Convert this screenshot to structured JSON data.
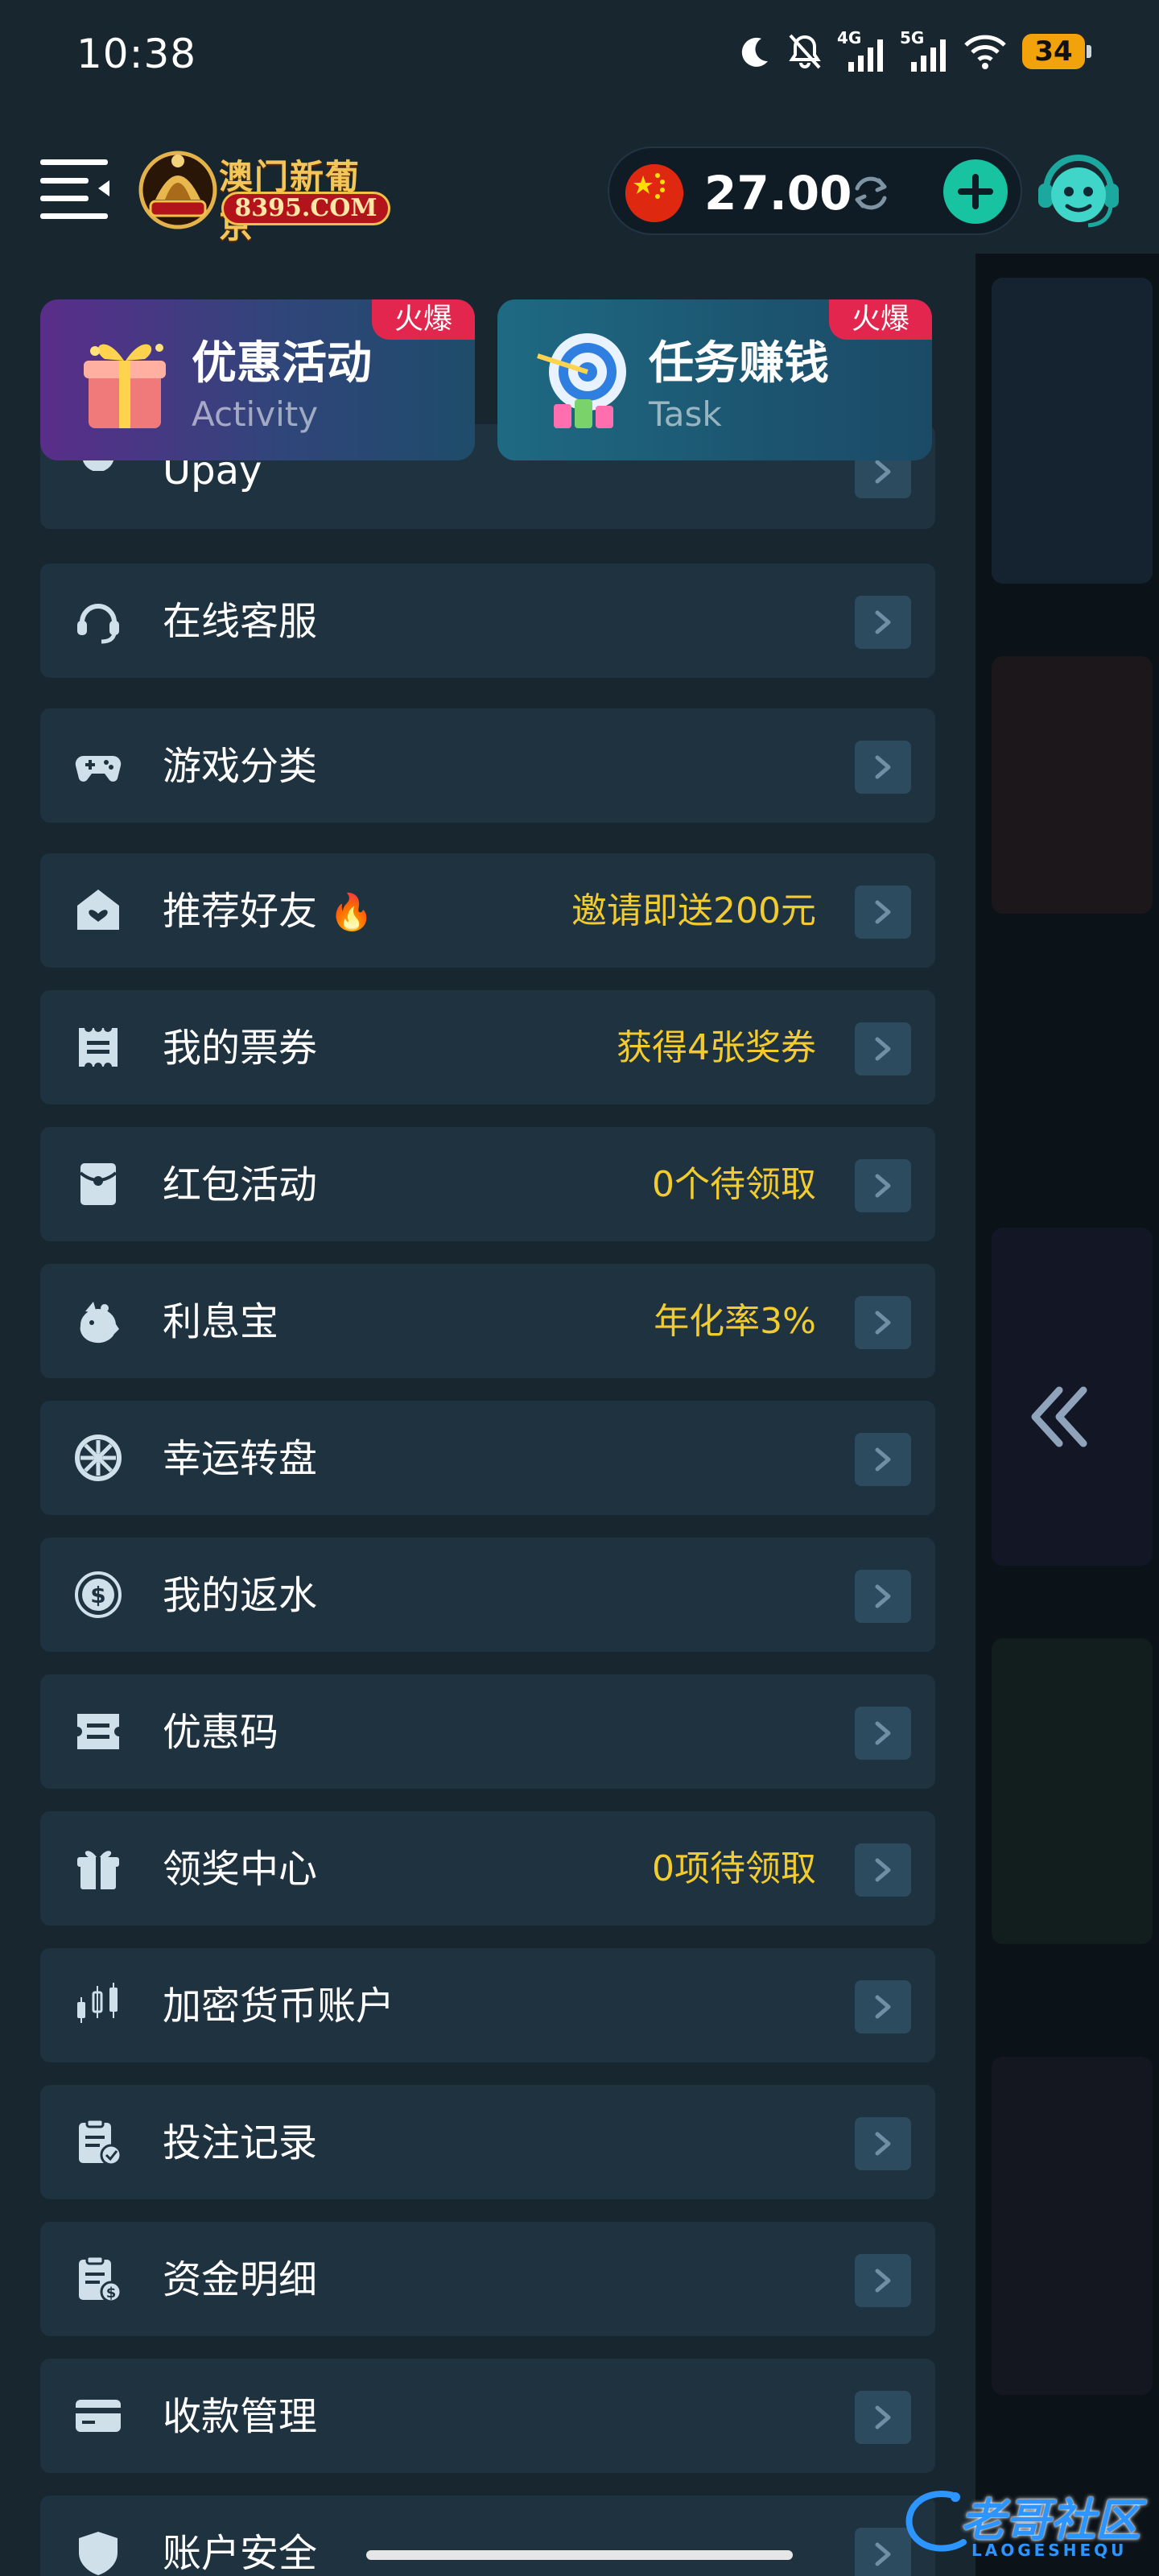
{
  "status_bar": {
    "time": "10:38",
    "network_4g": "4G",
    "network_5g": "5G",
    "battery": "34"
  },
  "header": {
    "logo_name": "澳门新葡京",
    "logo_domain": "8395.COM",
    "balance": "27.00",
    "currency_flag": "china-flag-icon"
  },
  "promos": [
    {
      "title": "优惠活动",
      "subtitle": "Activity",
      "badge": "火爆"
    },
    {
      "title": "任务赚钱",
      "subtitle": "Task",
      "badge": "火爆"
    }
  ],
  "menu": [
    {
      "label": "Upay",
      "extra": "",
      "icon": "upay-icon"
    },
    {
      "label": "在线客服",
      "extra": "",
      "icon": "headset-icon"
    },
    {
      "label": "游戏分类",
      "extra": "",
      "icon": "gamepad-icon"
    },
    {
      "label": "推荐好友",
      "extra": "邀请即送200元",
      "icon": "referral-icon"
    },
    {
      "label": "我的票券",
      "extra": "获得4张奖券",
      "icon": "ticket-icon"
    },
    {
      "label": "红包活动",
      "extra": "0个待领取",
      "icon": "red-envelope-icon"
    },
    {
      "label": "利息宝",
      "extra": "年化率3%",
      "icon": "piggy-icon"
    },
    {
      "label": "幸运转盘",
      "extra": "",
      "icon": "wheel-icon"
    },
    {
      "label": "我的返水",
      "extra": "",
      "icon": "dollar-coin-icon"
    },
    {
      "label": "优惠码",
      "extra": "",
      "icon": "coupon-code-icon"
    },
    {
      "label": "领奖中心",
      "extra": "0项待领取",
      "icon": "gift-icon"
    },
    {
      "label": "加密货币账户",
      "extra": "",
      "icon": "crypto-chart-icon"
    },
    {
      "label": "投注记录",
      "extra": "",
      "icon": "bet-record-icon"
    },
    {
      "label": "资金明细",
      "extra": "",
      "icon": "funds-detail-icon"
    },
    {
      "label": "收款管理",
      "extra": "",
      "icon": "card-icon"
    },
    {
      "label": "账户安全",
      "extra": "",
      "icon": "shield-icon"
    }
  ],
  "watermark": {
    "text": "老哥社区",
    "sub": "LAOGESHEQU"
  },
  "colors": {
    "background": "#17262f",
    "menu_item": "#1e3240",
    "highlight_text": "#f2cc2f",
    "badge": "#e2264d",
    "add_button": "#17c3a1"
  }
}
